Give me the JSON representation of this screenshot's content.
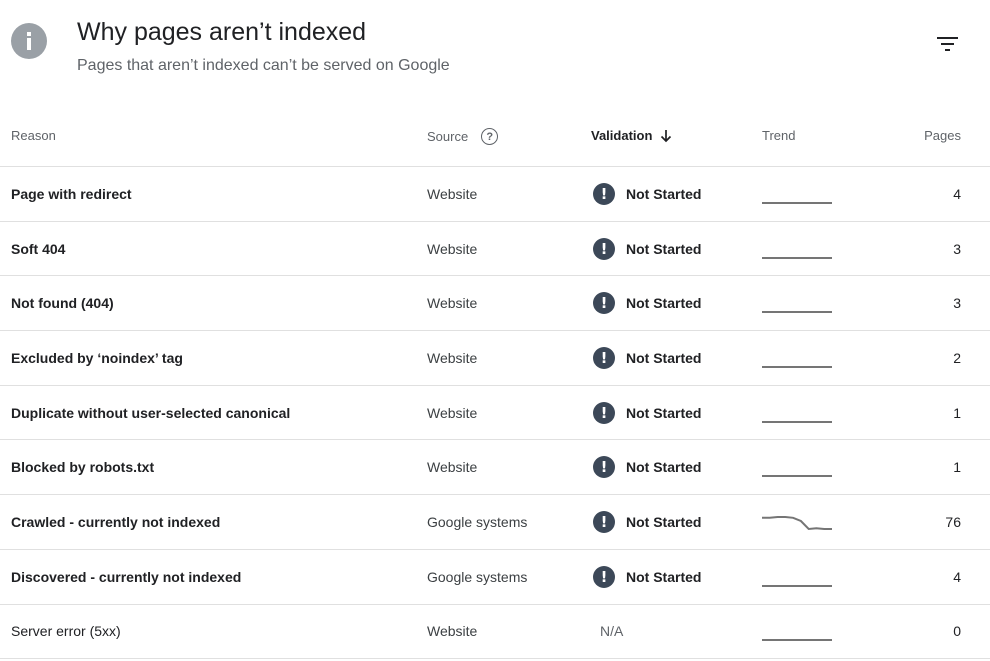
{
  "header": {
    "title": "Why pages aren’t indexed",
    "subtitle": "Pages that aren’t indexed can’t be served on Google",
    "info_icon": "info-icon",
    "filter_icon": "filter-icon"
  },
  "table": {
    "columns": {
      "reason": "Reason",
      "source": "Source",
      "validation": "Validation",
      "trend": "Trend",
      "pages": "Pages"
    },
    "rows": [
      {
        "reason": "Page with redirect",
        "source": "Website",
        "validation": "Not Started",
        "pages": "4",
        "trend": [
          4,
          4,
          4,
          4,
          4,
          4,
          4,
          4
        ]
      },
      {
        "reason": "Soft 404",
        "source": "Website",
        "validation": "Not Started",
        "pages": "3",
        "trend": [
          3,
          3,
          3,
          3,
          3,
          3,
          3,
          3
        ]
      },
      {
        "reason": "Not found (404)",
        "source": "Website",
        "validation": "Not Started",
        "pages": "3",
        "trend": [
          3,
          3,
          3,
          3,
          3,
          3,
          3,
          3
        ]
      },
      {
        "reason": "Excluded by ‘noindex’ tag",
        "source": "Website",
        "validation": "Not Started",
        "pages": "2",
        "trend": [
          2,
          2,
          2,
          2,
          2,
          2,
          2,
          2
        ]
      },
      {
        "reason": "Duplicate without user-selected canonical",
        "source": "Website",
        "validation": "Not Started",
        "pages": "1",
        "trend": [
          1,
          1,
          1,
          1,
          1,
          1,
          1,
          1
        ]
      },
      {
        "reason": "Blocked by robots.txt",
        "source": "Website",
        "validation": "Not Started",
        "pages": "1",
        "trend": [
          1,
          1,
          1,
          1,
          1,
          1,
          1,
          1
        ]
      },
      {
        "reason": "Crawled - currently not indexed",
        "source": "Google systems",
        "validation": "Not Started",
        "pages": "76",
        "trend": [
          90,
          90,
          91,
          91,
          90,
          86,
          76,
          77,
          76,
          76
        ]
      },
      {
        "reason": "Discovered - currently not indexed",
        "source": "Google systems",
        "validation": "Not Started",
        "pages": "4",
        "trend": [
          4,
          4,
          4,
          4,
          4,
          4,
          4,
          4
        ]
      },
      {
        "reason": "Server error (5xx)",
        "source": "Website",
        "validation": "N/A",
        "pages": "0",
        "trend": [
          0,
          0,
          0,
          0,
          0,
          0,
          0,
          0
        ]
      }
    ]
  },
  "colors": {
    "warn_icon": "#3c4858",
    "divider": "#e0e0e0",
    "trend_line": "#757575"
  }
}
